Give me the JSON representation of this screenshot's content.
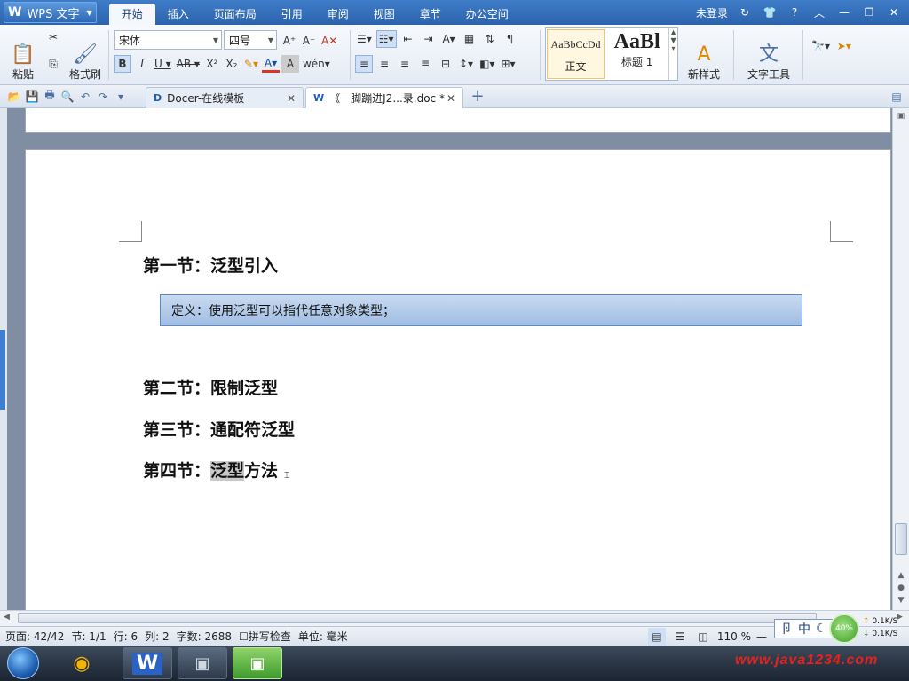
{
  "app": {
    "logo": "W",
    "title": "WPS 文字",
    "menu_tabs": [
      {
        "label": "开始",
        "active": true
      },
      {
        "label": "插入"
      },
      {
        "label": "页面布局"
      },
      {
        "label": "引用"
      },
      {
        "label": "审阅"
      },
      {
        "label": "视图"
      },
      {
        "label": "章节"
      },
      {
        "label": "办公空间"
      }
    ],
    "login_label": "未登录"
  },
  "ribbon": {
    "paste_label": "粘贴",
    "format_painter_label": "格式刷",
    "font_name": "宋体",
    "font_size": "四号",
    "styles": [
      {
        "preview": "AaBbCcDd",
        "label": "正文"
      },
      {
        "preview": "AaBl",
        "label": "标题 1"
      }
    ],
    "new_style_label": "新样式",
    "text_tools_label": "文字工具"
  },
  "doc_tabs": [
    {
      "label": "Docer-在线模板",
      "active": false
    },
    {
      "label": "《一脚蹦进J2...录.doc *",
      "active": true
    }
  ],
  "document": {
    "headings": [
      {
        "prefix": "第一节：",
        "text": "泛型引入"
      },
      {
        "prefix": "第二节：",
        "text": "限制泛型"
      },
      {
        "prefix": "第三节：",
        "text": "通配符泛型"
      },
      {
        "prefix": "第四节：",
        "text_selected": "泛型",
        "text": "方法"
      }
    ],
    "definition_text": "定义：使用泛型可以指代任意对象类型；"
  },
  "statusbar": {
    "page": "页面: 42/42",
    "section": "节: 1/1",
    "row": "行: 6",
    "col": "列: 2",
    "wordcount": "字数: 2688",
    "spellcheck": "拼写检查",
    "unit": "单位: 毫米",
    "zoom": "110 %"
  },
  "tray": {
    "ime_label": "中",
    "net_percent": "40%",
    "up_speed": "0.1K/S",
    "down_speed": "0.1K/S"
  },
  "watermark": "www.java1234.com",
  "colors": {
    "title_bar": "#2c63ad",
    "definition_box": "#9fbde3",
    "selection": "#c9c9c9",
    "watermark": "#e8211d"
  }
}
